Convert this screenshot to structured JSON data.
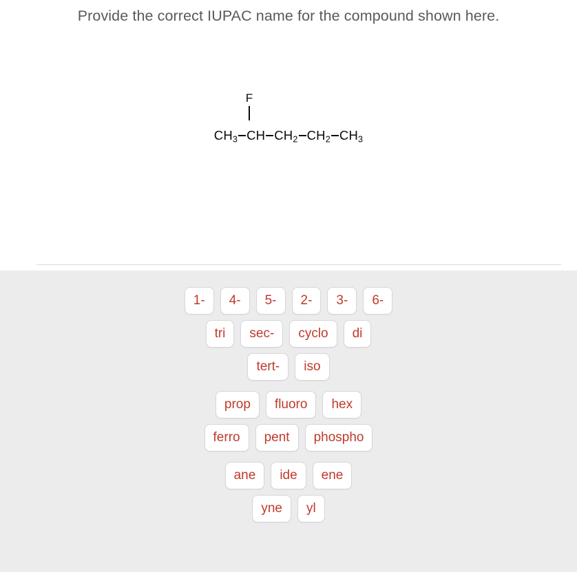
{
  "question": {
    "prompt": "Provide the correct IUPAC name for the compound shown here."
  },
  "structure": {
    "substituent": "F",
    "backbone": [
      {
        "group": "CH",
        "sub": "3"
      },
      {
        "group": "CH",
        "sub": ""
      },
      {
        "group": "CH",
        "sub": "2"
      },
      {
        "group": "CH",
        "sub": "2"
      },
      {
        "group": "CH",
        "sub": "3"
      }
    ],
    "formula_text": "CH3-CH(F)-CH2-CH2-CH3"
  },
  "answer_bank": {
    "groups": [
      {
        "rows": [
          {
            "tiles": [
              "1-",
              "4-",
              "5-",
              "2-",
              "3-",
              "6-"
            ]
          },
          {
            "tiles": [
              "tri",
              "sec-",
              "cyclo",
              "di"
            ]
          },
          {
            "tiles": [
              "tert-",
              "iso"
            ]
          }
        ]
      },
      {
        "rows": [
          {
            "tiles": [
              "prop",
              "fluoro",
              "hex"
            ]
          },
          {
            "tiles": [
              "ferro",
              "pent",
              "phospho"
            ]
          }
        ]
      },
      {
        "rows": [
          {
            "tiles": [
              "ane",
              "ide",
              "ene"
            ]
          },
          {
            "tiles": [
              "yne",
              "yl"
            ]
          }
        ]
      }
    ]
  },
  "colors": {
    "tile_text": "#c0392b",
    "tile_background": "#ffffff",
    "tile_border": "#d6d6d6",
    "panel_background": "#ececec",
    "question_text": "#58595b",
    "page_background": "#ffffff",
    "divider": "#dcdcdc",
    "structure_text": "#0b0b0b"
  }
}
